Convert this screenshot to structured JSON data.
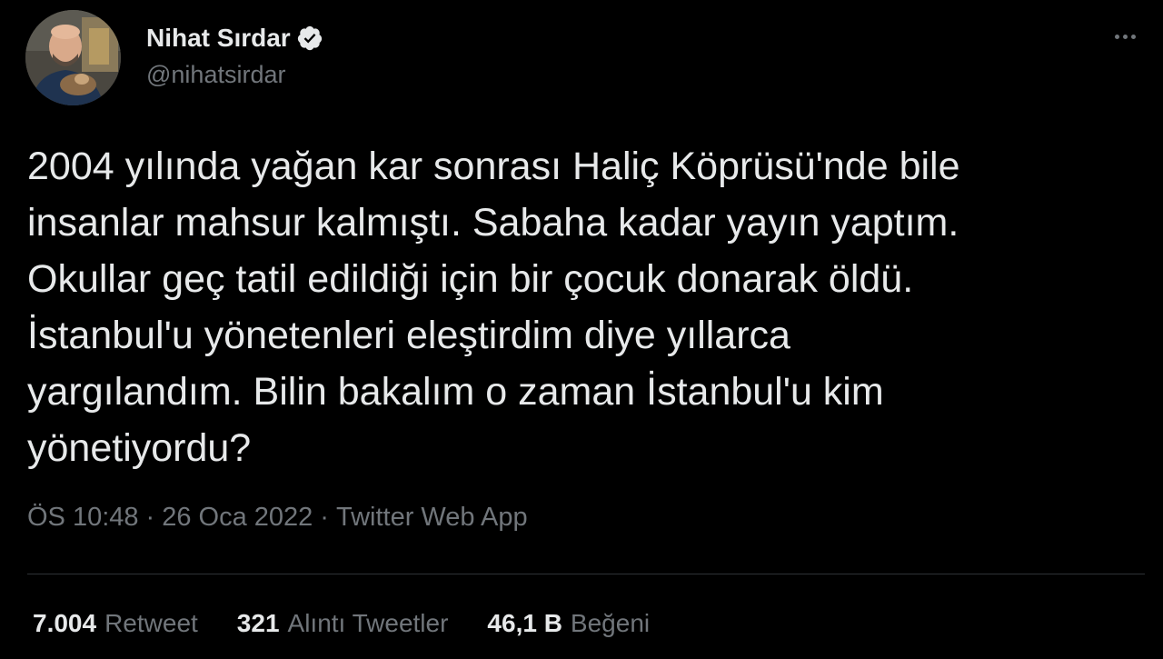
{
  "author": {
    "name": "Nihat Sırdar",
    "handle": "@nihatsirdar",
    "verified": true,
    "avatar_icon": "profile-photo"
  },
  "tweet": {
    "lines": [
      "2004 yılında yağan kar sonrası Haliç Köprüsü'nde bile",
      "insanlar mahsur kalmıştı. Sabaha kadar yayın yaptım.",
      "Okullar geç tatil edildiği için bir çocuk donarak öldü.",
      "İstanbul'u yönetenleri eleştirdim diye yıllarca",
      "yargılandım. Bilin bakalım o zaman İstanbul'u kim",
      "yönetiyordu?"
    ]
  },
  "meta": {
    "time": "ÖS 10:48",
    "separator": "·",
    "date": "26 Oca 2022",
    "source": "Twitter Web App"
  },
  "stats": {
    "retweets": {
      "count": "7.004",
      "label": "Retweet"
    },
    "quotes": {
      "count": "321",
      "label": "Alıntı Tweetler"
    },
    "likes": {
      "count": "46,1 B",
      "label": "Beğeni"
    }
  },
  "icons": {
    "verified": "verified-badge-icon",
    "more": "more-options-icon"
  },
  "colors": {
    "background": "#000000",
    "text_primary": "#e7e9ea",
    "text_secondary": "#71767b",
    "divider": "#2f3336",
    "verified_badge": "#e7e9ea"
  }
}
